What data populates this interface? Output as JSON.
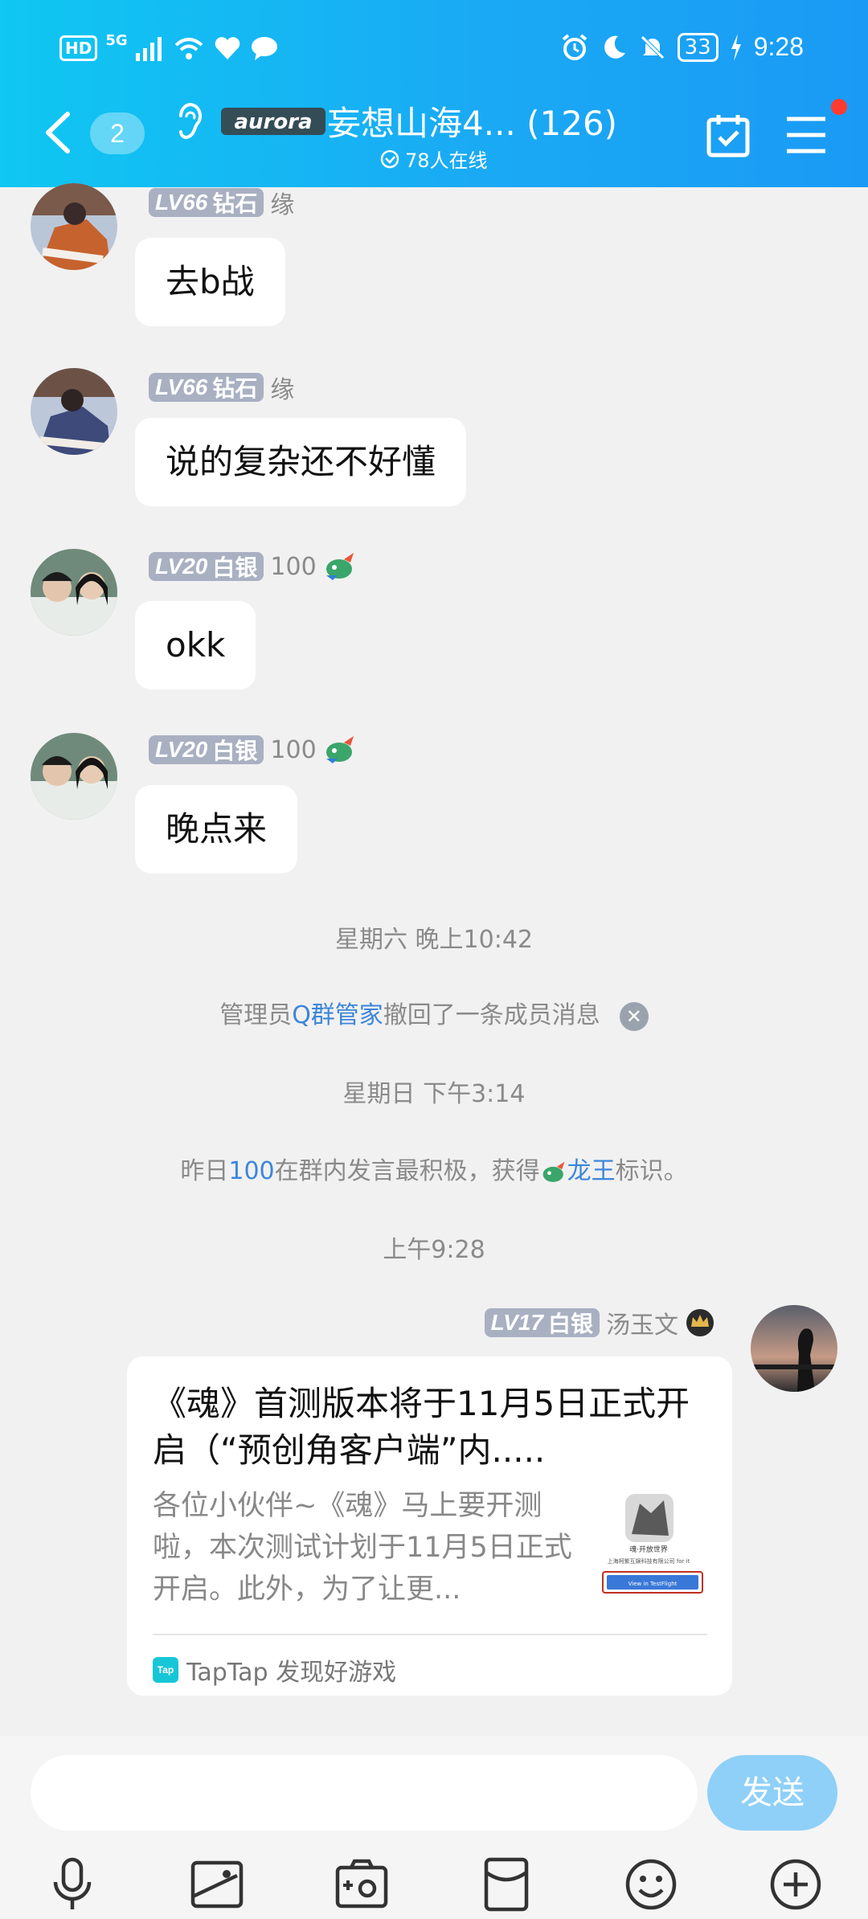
{
  "status_bar": {
    "hd": "HD",
    "network": "5G",
    "battery": "33",
    "time": "9:28"
  },
  "header": {
    "unread_count": "2",
    "logo_text": "aurora",
    "title": "妄想山海4... (126)",
    "online": "78人在线"
  },
  "messages": [
    {
      "level": "LV66",
      "rank": "钻石",
      "name": "缘",
      "text": "去b战"
    },
    {
      "level": "LV66",
      "rank": "钻石",
      "name": "缘",
      "text": "说的复杂还不好懂"
    },
    {
      "level": "LV20",
      "rank": "白银",
      "name": "100",
      "text": "okk"
    },
    {
      "level": "LV20",
      "rank": "白银",
      "name": "100",
      "text": "晚点来"
    }
  ],
  "system": {
    "time1": "星期六 晚上10:42",
    "recall_prefix": "管理员",
    "recall_admin": "Q群管家",
    "recall_suffix": "撤回了一条成员消息",
    "time2": "星期日 下午3:14",
    "dragon_prefix": "昨日",
    "dragon_user": "100",
    "dragon_mid": "在群内发言最积极，获得",
    "dragon_title": "龙王",
    "dragon_suffix": "标识。",
    "time3": "上午9:28"
  },
  "own_message": {
    "level": "LV17",
    "rank": "白银",
    "name": "汤玉文",
    "card": {
      "title": "《魂》首测版本将于11月5日正式开启（“预创角客户端”内.....",
      "description": "各位小伙伴~《魂》马上要开测啦，本次测试计划于11月5日正式开启。此外，为了让更...",
      "source": "TapTap 发现好游戏",
      "source_logo": "Tap",
      "thumb_caption1": "魂·开放世界",
      "thumb_caption2": "上海柯紫互娱科技有限公司 for it",
      "thumb_button": "View in TestFlight"
    }
  },
  "input": {
    "placeholder": "",
    "send_label": "发送"
  },
  "colors": {
    "header_start": "#0fc7f2",
    "header_end": "#1a9af5",
    "link": "#3d86d9",
    "send": "#8fd0f8"
  }
}
